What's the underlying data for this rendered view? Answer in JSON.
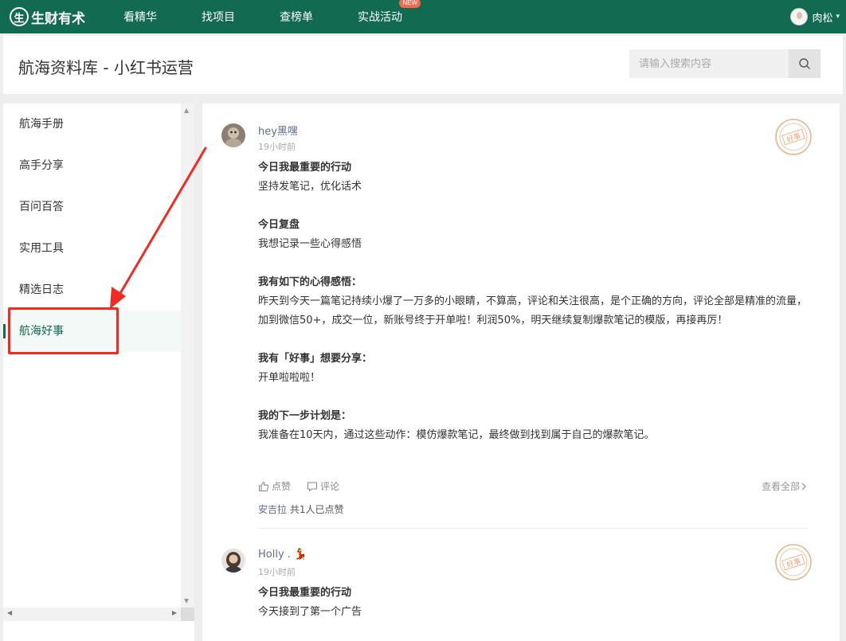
{
  "topbar": {
    "logo_mark": "生",
    "logo_text": "生财有术",
    "nav": [
      {
        "label": "看精华"
      },
      {
        "label": "找项目"
      },
      {
        "label": "查榜单"
      },
      {
        "label": "实战活动",
        "badge": "NEW"
      }
    ],
    "user_name": "肉松",
    "caret": "▾"
  },
  "header": {
    "title": "航海资料库 - 小红书运营",
    "search_placeholder": "请输入搜索内容"
  },
  "sidebar": {
    "items": [
      {
        "label": "航海手册"
      },
      {
        "label": "高手分享"
      },
      {
        "label": "百问百答"
      },
      {
        "label": "实用工具"
      },
      {
        "label": "精选日志"
      },
      {
        "label": "航海好事",
        "active": true
      }
    ],
    "scroll_up": "▲",
    "scroll_down": "▼",
    "scroll_left": "◀",
    "scroll_right": "▶"
  },
  "posts": [
    {
      "author": "hey黑嘿",
      "time": "19小时前",
      "stamp": "好事",
      "blocks": [
        {
          "heading": "今日我最重要的行动",
          "text": "坚持发笔记，优化话术"
        },
        {
          "heading": "今日复盘",
          "text": "我想记录一些心得感悟"
        },
        {
          "heading": "我有如下的心得感悟：",
          "text": "昨天到今天一篇笔记持续小爆了一万多的小眼睛，不算高，评论和关注很高，是个正确的方向，评论全部是精准的流量，加到微信50+，成交一位，新账号终于开单啦！利润50%，明天继续复制爆款笔记的模版，再接再厉！"
        },
        {
          "heading": "我有「好事」想要分享：",
          "text": "开单啦啦啦！"
        },
        {
          "heading": "我的下一步计划是：",
          "text": "我准备在10天内，通过这些动作：模仿爆款笔记，最终做到找到属于自己的爆款笔记。"
        }
      ],
      "like_label": "点赞",
      "comment_label": "评论",
      "view_all": "查看全部",
      "liker": "安吉拉",
      "likes_text": "共1人已点赞"
    },
    {
      "author": "Holly .",
      "author_emoji": "💃",
      "time": "19小时前",
      "stamp": "好事",
      "blocks": [
        {
          "heading": "今日我最重要的行动",
          "text": "今天接到了第一个广告"
        }
      ]
    }
  ],
  "colors": {
    "brand": "#126a50",
    "annotation": "#f12a22",
    "link": "#5b6e96",
    "badge": "#f06a4e"
  }
}
